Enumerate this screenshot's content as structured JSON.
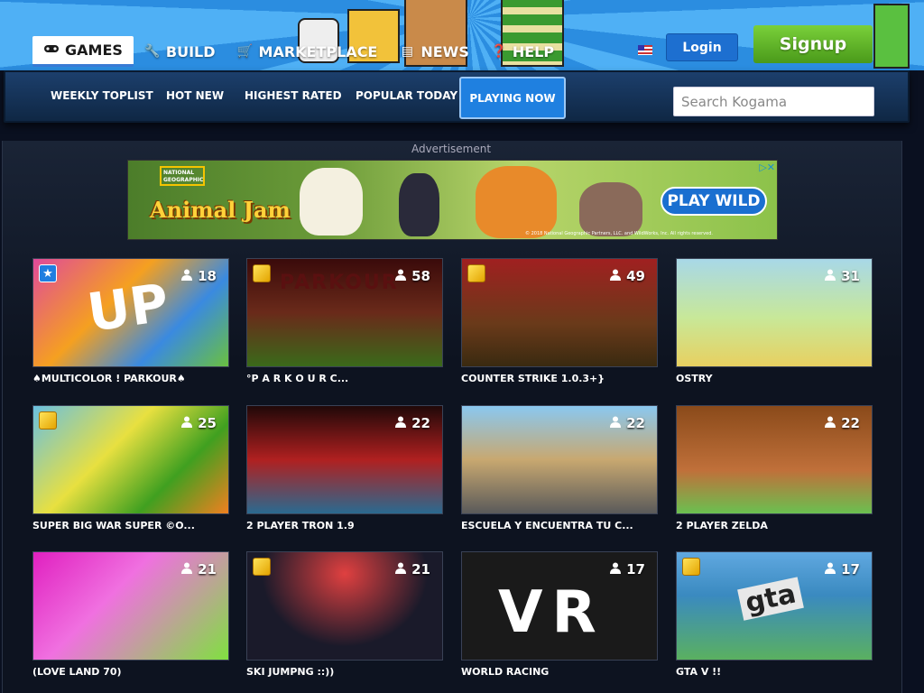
{
  "header": {
    "nav": [
      {
        "label": "GAMES",
        "icon": "gamepad-icon",
        "active": true
      },
      {
        "label": "BUILD",
        "icon": "wrench-icon"
      },
      {
        "label": "MARKETPLACE",
        "icon": "cart-icon"
      },
      {
        "label": "NEWS",
        "icon": "newspaper-icon"
      },
      {
        "label": "HELP",
        "icon": "question-icon"
      }
    ],
    "login_label": "Login",
    "signup_label": "Signup"
  },
  "subnav": {
    "tabs": [
      "WEEKLY TOPLIST",
      "HOT NEW",
      "HIGHEST RATED",
      "POPULAR TODAY",
      "PLAYING NOW"
    ],
    "active_tab": "PLAYING NOW",
    "search_placeholder": "Search Kogama"
  },
  "ad": {
    "label": "Advertisement",
    "brand": "NATIONAL GEOGRAPHIC",
    "title": "Animal Jam",
    "cta": "PLAY WILD",
    "footer": "© 2018 National Geographic Partners, LLC. and WildWorks, Inc. All rights reserved."
  },
  "games": [
    {
      "title": "♠MULTICOLOR ! PARKOUR♠",
      "players": "18",
      "badge": "star"
    },
    {
      "title": "°P A R K O U R C...",
      "players": "58",
      "badge": "gold"
    },
    {
      "title": "COUNTER STRIKE 1.0.3+}",
      "players": "49",
      "badge": "gold"
    },
    {
      "title": "OSTRY",
      "players": "31",
      "badge": ""
    },
    {
      "title": "SUPER BIG WAR SUPER ©O...",
      "players": "25",
      "badge": "gold"
    },
    {
      "title": "2 PLAYER TRON 1.9",
      "players": "22",
      "badge": ""
    },
    {
      "title": "ESCUELA Y ENCUENTRA TU C...",
      "players": "22",
      "badge": ""
    },
    {
      "title": "2 PLAYER ZELDA",
      "players": "22",
      "badge": ""
    },
    {
      "title": "(LOVE LAND 70)",
      "players": "21",
      "badge": ""
    },
    {
      "title": "SKI JUMPNG ::))",
      "players": "21",
      "badge": "gold"
    },
    {
      "title": "WORLD RACING",
      "players": "17",
      "badge": ""
    },
    {
      "title": "GTA V !!",
      "players": "17",
      "badge": "gold"
    }
  ],
  "thumb_text": {
    "parkour": "PARKOUR",
    "up": "UP",
    "vr": "VR",
    "gta": "gta"
  }
}
